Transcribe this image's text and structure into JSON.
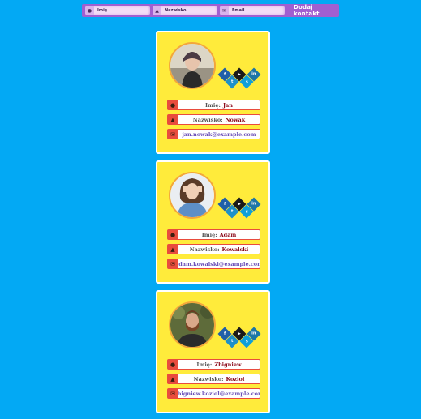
{
  "form": {
    "fields": [
      {
        "icon": "user-icon",
        "label": "Imię"
      },
      {
        "icon": "user-tie-icon",
        "label": "Nazwisko"
      },
      {
        "icon": "envelope-icon",
        "label": "Email"
      }
    ],
    "submit_label": "Dodaj kontakt"
  },
  "cards": [
    {
      "first_label": "Imię:",
      "first": "Jan",
      "last_label": "Nazwisko:",
      "last": "Nowak",
      "email": "jan.nowak@example.com"
    },
    {
      "first_label": "Imię:",
      "first": "Adam",
      "last_label": "Nazwisko:",
      "last": "Kowalski",
      "email": "adam.kowalski@example.com"
    },
    {
      "first_label": "Imię:",
      "first": "Zbigniew",
      "last_label": "Nazwisko:",
      "last": "Kozioł",
      "email": "zbigniew.koziol@example.com"
    }
  ],
  "social": {
    "facebook": "f",
    "twitter": "t",
    "youtube": "▶",
    "skype": "s",
    "linkedin": "in"
  },
  "colors": {
    "background": "#03a9f4",
    "card": "#ffeb3b",
    "accent": "#e94c3d",
    "form": "#a15fd0"
  }
}
